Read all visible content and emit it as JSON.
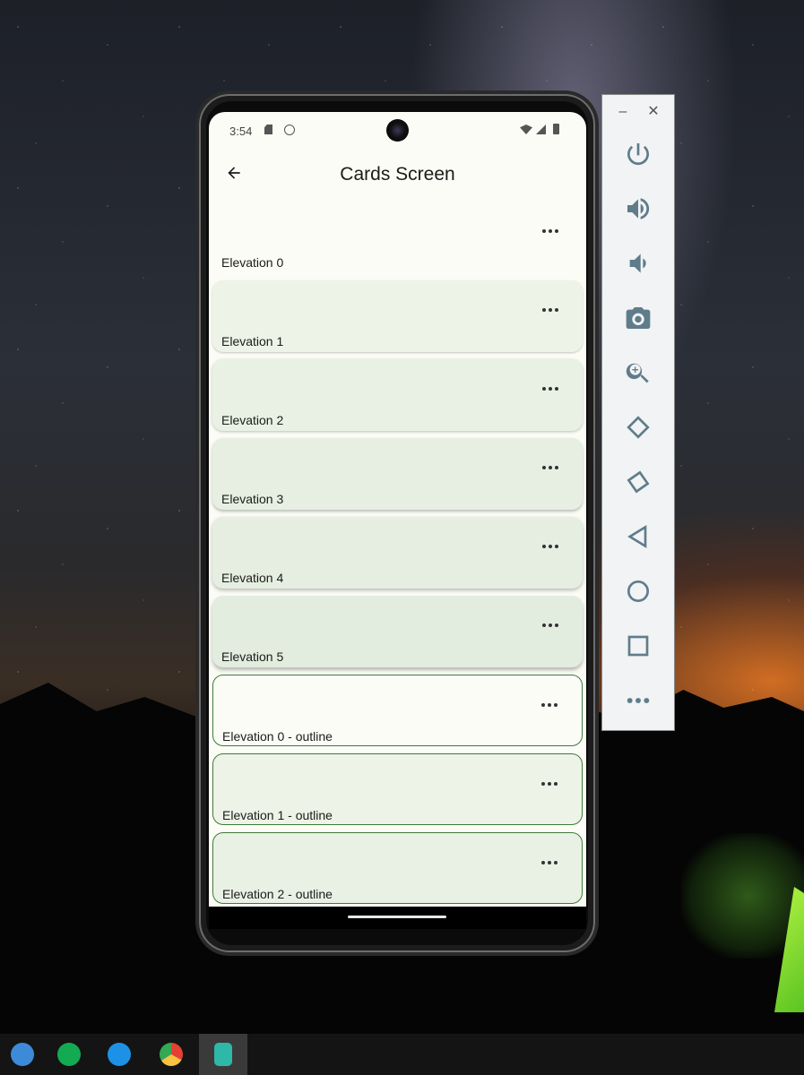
{
  "phone": {
    "status_bar": {
      "time": "3:54",
      "icons": [
        "sd-card-icon",
        "sync-icon",
        "wifi-icon",
        "signal-icon",
        "battery-icon"
      ]
    },
    "app_bar": {
      "title": "Cards Screen",
      "back_icon": "arrow-back-icon"
    },
    "cards": [
      {
        "label": "Elevation 0",
        "style": "elevated",
        "background": "#fbfcf5"
      },
      {
        "label": "Elevation 1",
        "style": "elevated",
        "background": "#eef3e8"
      },
      {
        "label": "Elevation 2",
        "style": "elevated",
        "background": "#e9f1e5"
      },
      {
        "label": "Elevation 3",
        "style": "elevated",
        "background": "#e6efe2"
      },
      {
        "label": "Elevation 4",
        "style": "elevated",
        "background": "#e5eee1"
      },
      {
        "label": "Elevation 5",
        "style": "elevated",
        "background": "#e2ecdf"
      },
      {
        "label": "Elevation 0 - outline",
        "style": "outline",
        "background": "#fbfcf5"
      },
      {
        "label": "Elevation 1 - outline",
        "style": "outline",
        "background": "#eef3e8"
      },
      {
        "label": "Elevation 2 - outline",
        "style": "outline",
        "background": "#e9f1e5"
      }
    ],
    "card_menu_icon": "more-horiz-icon"
  },
  "emulator_toolbar": {
    "window_controls": {
      "minimize": "–",
      "close": "✕"
    },
    "buttons": [
      "power-icon",
      "volume-up-icon",
      "volume-down-icon",
      "camera-icon",
      "zoom-icon",
      "rotate-left-icon",
      "rotate-right-icon",
      "back-triangle-icon",
      "home-circle-icon",
      "overview-square-icon",
      "more-icon"
    ],
    "icon_color": "#5f7c8a"
  },
  "taskbar": {
    "apps": [
      {
        "name": "android-studio-icon",
        "color": "#3d8ad8",
        "active": false
      },
      {
        "name": "mongodb-compass-icon",
        "color": "#13aa52",
        "active": false
      },
      {
        "name": "docker-icon",
        "color": "#1d91e6",
        "active": false
      },
      {
        "name": "chrome-icon",
        "color": "#e44134",
        "active": false
      },
      {
        "name": "android-emulator-icon",
        "color": "#2fb7a8",
        "active": true
      }
    ]
  }
}
